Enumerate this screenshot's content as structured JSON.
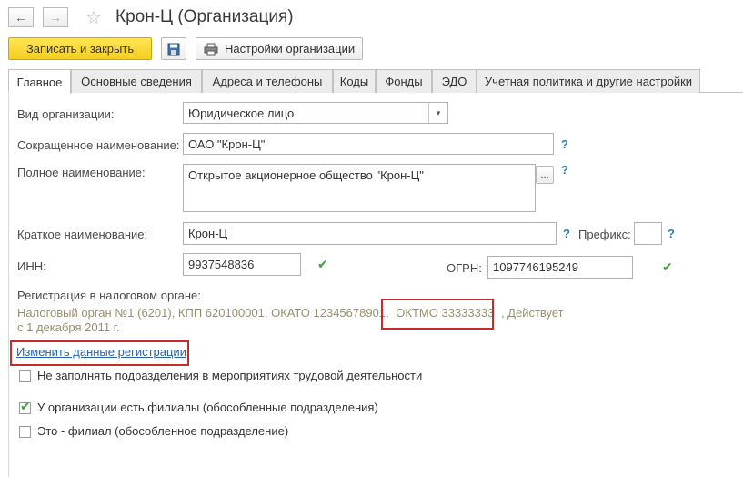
{
  "window": {
    "title": "Крон-Ц (Организация)",
    "back_icon": "arrow-left",
    "forward_icon": "arrow-right",
    "favorite_icon": "star"
  },
  "toolbar": {
    "save_close": "Записать и закрыть",
    "settings": "Настройки организации"
  },
  "tabs": [
    "Главное",
    "Основные сведения",
    "Адреса и телефоны",
    "Коды",
    "Фонды",
    "ЭДО",
    "Учетная политика и другие настройки"
  ],
  "form": {
    "org_type_label": "Вид организации:",
    "org_type_value": "Юридическое лицо",
    "short_name_label": "Сокращенное наименование:",
    "short_name_value": "ОАО \"Крон-Ц\"",
    "full_name_label": "Полное наименование:",
    "full_name_value": "Открытое акционерное общество \"Крон-Ц\"",
    "full_name_button": "...",
    "brief_name_label": "Краткое наименование:",
    "brief_name_value": "Крон-Ц",
    "prefix_label": "Префикс:",
    "prefix_value": "",
    "inn_label": "ИНН:",
    "inn_value": "9937548836",
    "ogrn_label": "ОГРН:",
    "ogrn_value": "1097746195249",
    "help": "?"
  },
  "registration": {
    "label": "Регистрация в налоговом органе:",
    "line1_part1": "Налоговый орган №1 (6201), КПП 620100001, ОКАТО 12345678901,",
    "oktmo": "ОКТМО 33333333",
    "line1_part2": ", Действует",
    "line2": "с 1 декабря 2011 г.",
    "change_link": "Изменить данные регистрации"
  },
  "checkboxes": [
    {
      "label": "Не заполнять подразделения в мероприятиях трудовой деятельности",
      "checked": false
    },
    {
      "label": "У организации есть филиалы (обособленные подразделения)",
      "checked": true
    },
    {
      "label": "Это - филиал (обособленное подразделение)",
      "checked": false
    }
  ],
  "colors": {
    "primary_button": "#f4cf21",
    "highlight_border": "#c72a2a",
    "link": "#2a62a8",
    "help_icon": "#2a7ab8",
    "check_mark": "#3aa33a"
  }
}
